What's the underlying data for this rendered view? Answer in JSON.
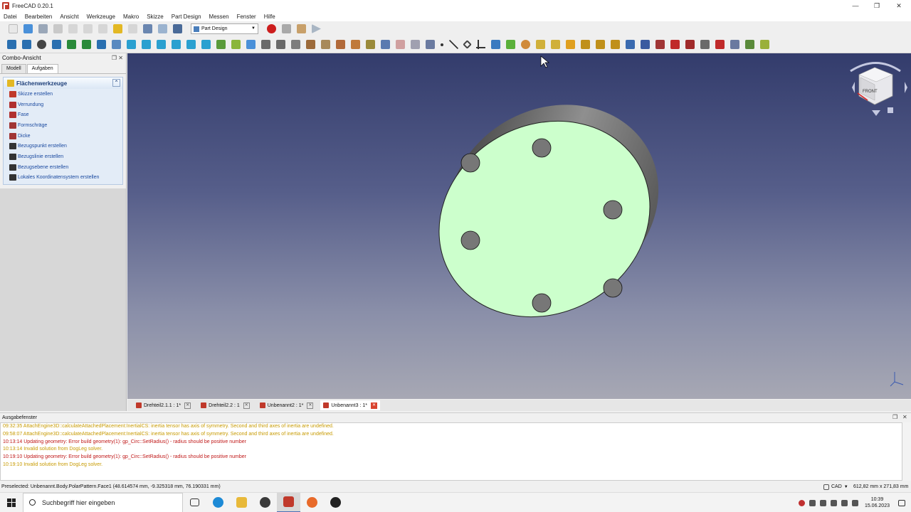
{
  "window": {
    "title": "FreeCAD 0.20.1",
    "controls": [
      "—",
      "❐",
      "✕"
    ]
  },
  "menu": [
    "Datei",
    "Bearbeiten",
    "Ansicht",
    "Werkzeuge",
    "Makro",
    "Skizze",
    "Part Design",
    "Messen",
    "Fenster",
    "Hilfe"
  ],
  "workbench": {
    "selected": "Part Design"
  },
  "combo_view": {
    "title": "Combo-Ansicht",
    "tabs": [
      "Modell",
      "Aufgaben"
    ],
    "active_tab": "Aufgaben",
    "panel_title": "Flächenwerkzeuge",
    "tasks": [
      {
        "label": "Skizze erstellen",
        "icon": "sketch-icon",
        "color": "#c0392b"
      },
      {
        "label": "Verrundung",
        "icon": "fillet-icon",
        "color": "#b03030"
      },
      {
        "label": "Fase",
        "icon": "chamfer-icon",
        "color": "#b03030"
      },
      {
        "label": "Formschräge",
        "icon": "draft-icon",
        "color": "#a03535"
      },
      {
        "label": "Dicke",
        "icon": "thickness-icon",
        "color": "#a03535"
      },
      {
        "label": "Bezugspunkt erstellen",
        "icon": "datum-point-icon",
        "color": "#333333"
      },
      {
        "label": "Bezugslinie erstellen",
        "icon": "datum-line-icon",
        "color": "#333333"
      },
      {
        "label": "Bezugsebene erstellen",
        "icon": "datum-plane-icon",
        "color": "#333333"
      },
      {
        "label": "Lokales Koordinatensystem erstellen",
        "icon": "coordinate-system-icon",
        "color": "#333333"
      }
    ]
  },
  "view3d": {
    "navcube_face": "FRONT",
    "part_face_color": "#ccffcc",
    "part_side_color": "#8a8a8a"
  },
  "doc_tabs": [
    {
      "label": "Drehteil2.1.1 : 1*"
    },
    {
      "label": "Drehteil2.2 : 1"
    },
    {
      "label": "Unbenannt2 : 1*"
    },
    {
      "label": "Unbenannt3 : 1*"
    }
  ],
  "output": {
    "title": "Ausgabefenster",
    "lines": [
      {
        "level": "warn",
        "text": "09:32:35  AttachEngine3D::calculateAttachedPlacement:InertialCS: inertia tensor has axis of symmetry. Second and third axes of inertia are undefined."
      },
      {
        "level": "warn",
        "text": "09:58:07  AttachEngine3D::calculateAttachedPlacement:InertialCS: inertia tensor has axis of symmetry. Second and third axes of inertia are undefined."
      },
      {
        "level": "err",
        "text": "10:13:14  Updating geometry: Error build geometry(1): gp_Circ::SetRadius() - radius should be positive number"
      },
      {
        "level": "warn",
        "text": "10:13:14  Invalid solution from DogLeg solver."
      },
      {
        "level": "err",
        "text": "10:19:10  Updating geometry: Error build geometry(1): gp_Circ::SetRadius() - radius should be positive number"
      },
      {
        "level": "warn",
        "text": "10:19:10  Invalid solution from DogLeg solver."
      }
    ]
  },
  "status": {
    "preselected": "Preselected: Unbenannt.Body.PolarPattern.Face1 (48.614574 mm, -9.325318 mm, 76.190331 mm)",
    "nav_style": "CAD",
    "dimensions": "612,82 mm x 271,83 mm"
  },
  "taskbar": {
    "search_placeholder": "Suchbegriff hier eingeben",
    "time": "10:39",
    "date": "15.06.2023"
  }
}
